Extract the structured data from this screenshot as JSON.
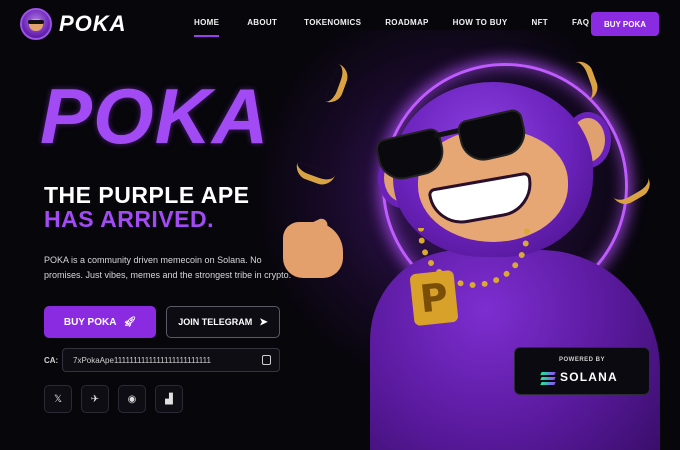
{
  "brand": {
    "name": "POKA"
  },
  "nav": {
    "items": [
      {
        "label": "HOME",
        "active": true
      },
      {
        "label": "ABOUT"
      },
      {
        "label": "TOKENOMICS"
      },
      {
        "label": "ROADMAP"
      },
      {
        "label": "HOW TO BUY"
      },
      {
        "label": "NFT"
      },
      {
        "label": "FAQ"
      }
    ],
    "cta_label": "BUY POKA"
  },
  "hero": {
    "title": "POKA",
    "tagline_line1": "THE PURPLE APE",
    "tagline_line2": "HAS ARRIVED.",
    "description": "POKA is a community driven memecoin on Solana. No promises. Just vibes, memes and the strongest tribe in crypto.",
    "buy_label": "BUY POKA",
    "telegram_label": "JOIN TELEGRAM"
  },
  "contract": {
    "label": "CA:",
    "address": "7xPokaApe1111111111111111111111111"
  },
  "pendant_letter": "P",
  "socials": [
    {
      "icon": "x-icon",
      "glyph": "𝕏"
    },
    {
      "icon": "telegram-icon",
      "glyph": "✈"
    },
    {
      "icon": "discord-icon",
      "glyph": "◉"
    },
    {
      "icon": "chart-icon",
      "glyph": "▟"
    }
  ],
  "solana_badge": {
    "powered_label": "POWERED BY",
    "name": "SOLANA"
  },
  "colors": {
    "accent": "#8a2be2",
    "title_purple": "#a24bf5",
    "background": "#07060b"
  }
}
